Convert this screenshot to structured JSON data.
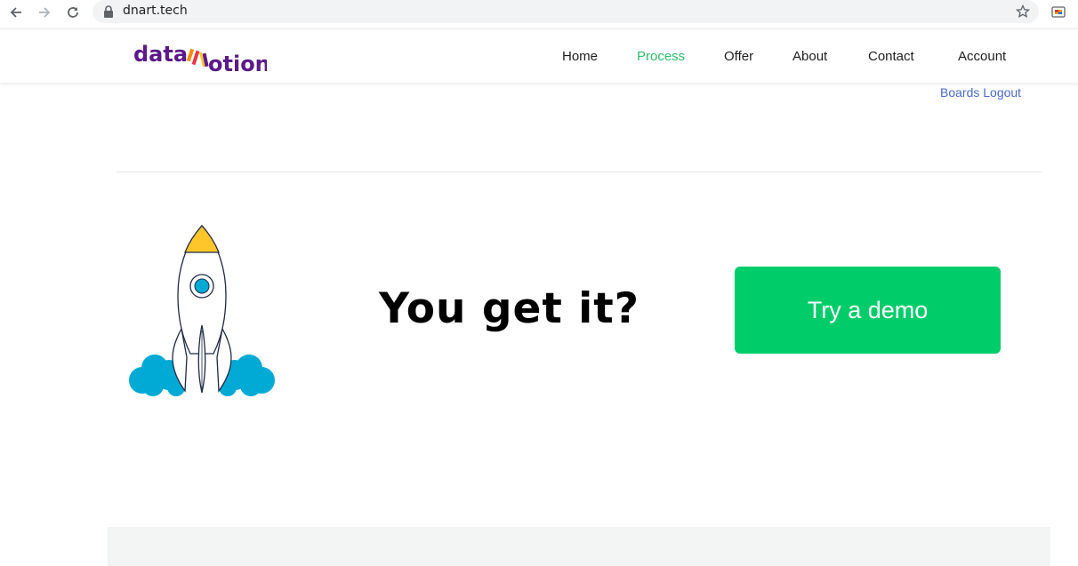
{
  "browser": {
    "url": "dnart.tech",
    "icons": [
      "back-arrow-icon",
      "forward-arrow-icon",
      "reload-icon",
      "lock-icon",
      "star-icon",
      "extension-icon"
    ]
  },
  "header": {
    "logo_text": "dataNotion",
    "nav": [
      {
        "label": "Home",
        "active": false
      },
      {
        "label": "Process",
        "active": true
      },
      {
        "label": "Offer",
        "active": false
      },
      {
        "label": "About",
        "active": false
      },
      {
        "label": "Contact",
        "active": false
      },
      {
        "label": "Account",
        "active": false
      }
    ],
    "sub_links": [
      "Boards",
      "Logout"
    ]
  },
  "hero": {
    "headline": "You get it?",
    "cta_label": "Try a demo"
  },
  "colors": {
    "accent_green": "#00cc6a",
    "nav_active": "#2ebd6b",
    "link_blue": "#4a69c9",
    "logo_purple": "#5b1a8a",
    "rocket_cloud": "#00aad4",
    "rocket_flame": "#ffc629"
  }
}
